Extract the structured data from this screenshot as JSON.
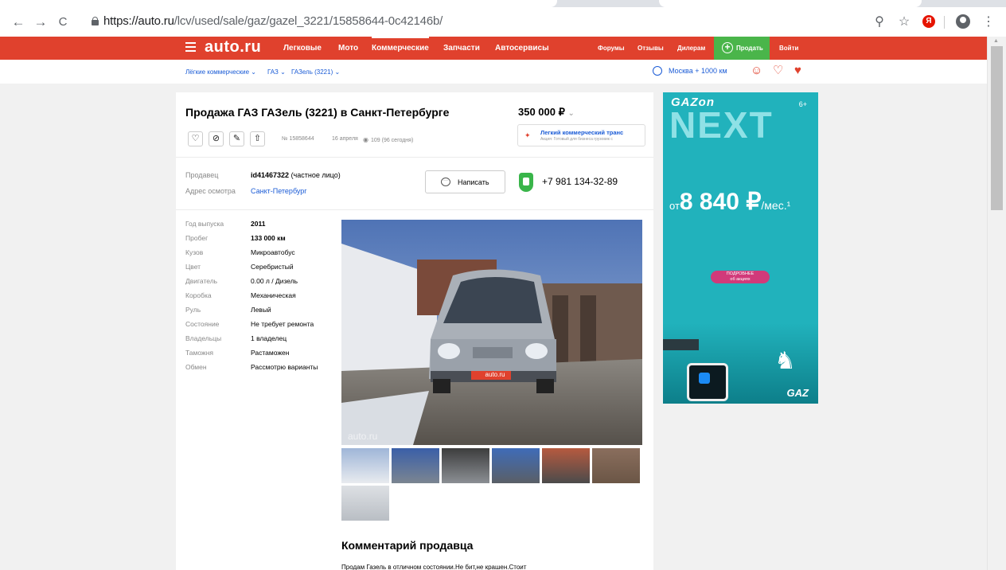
{
  "browser": {
    "url_host": "https://auto.ru",
    "url_path": "/lcv/used/sale/gaz/gazel_3221/15858644-0c42146b/"
  },
  "header": {
    "logo": "auto.ru",
    "nav": [
      "Легковые",
      "Мото",
      "Коммерческие",
      "Запчасти",
      "Автосервисы"
    ],
    "nav_small": [
      "Форумы",
      "Отзывы",
      "Дилерам"
    ],
    "sell": "Продать",
    "login": "Войти"
  },
  "subheader": {
    "crumbs": [
      "Лёгкие коммерческие",
      "ГАЗ",
      "ГАЗель (3221)"
    ],
    "location": "Москва + 1000 км"
  },
  "listing": {
    "title": "Продажа ГАЗ ГАЗель (3221) в Санкт-Петербурге",
    "price": "350 000 ₽",
    "id": "№ 15858644",
    "date": "16 апреля",
    "views": "109 (96 сегодня)",
    "promo_title": "Легкий коммерческий транс",
    "promo_sub": "Акция: Готовый для бизнеса грузовик с",
    "seller_label": "Продавец",
    "seller_id": "id41467322",
    "seller_type": "(частное лицо)",
    "address_label": "Адрес осмотра",
    "address": "Санкт-Петербург",
    "write_btn": "Написать",
    "phone": "+7 981 134-32-89"
  },
  "specs": [
    {
      "label": "Год выпуска",
      "value": "2011"
    },
    {
      "label": "Пробег",
      "value": "133 000 км"
    },
    {
      "label": "Кузов",
      "value": "Микроавтобус"
    },
    {
      "label": "Цвет",
      "value": "Серебристый"
    },
    {
      "label": "Двигатель",
      "value": "0.00 л / Дизель"
    },
    {
      "label": "Коробка",
      "value": "Механическая"
    },
    {
      "label": "Руль",
      "value": "Левый"
    },
    {
      "label": "Состояние",
      "value": "Не требует ремонта"
    },
    {
      "label": "Владельцы",
      "value": "1 владелец"
    },
    {
      "label": "Таможня",
      "value": "Растаможен"
    },
    {
      "label": "Обмен",
      "value": "Рассмотрю варианты"
    }
  ],
  "photo": {
    "plate": "auto.ru",
    "watermark": "auto.ru"
  },
  "comment": {
    "heading": "Комментарий продавца",
    "text": "Продам Газель в отличном состоянии.Не бит,не крашен.Стоит"
  },
  "ad": {
    "logo": "GAZon",
    "age": "6+",
    "headline": "NEXT",
    "from": "от",
    "amount": "8 840 ₽",
    "per": "/мес.¹",
    "btn_line1": "ПОДРОБНЕЕ",
    "btn_line2": "об акциях",
    "brand": "GAZ"
  },
  "icons": {
    "burger": "menu-icon",
    "location": "location-icon",
    "chat": "chat-icon",
    "favorite": "heart-icon",
    "compare": "compare-icon"
  },
  "colors": {
    "brand_red": "#e0412d",
    "sell_green": "#4ab54a",
    "link_blue": "#1a5bd6",
    "ad_teal": "#21b2bc"
  }
}
